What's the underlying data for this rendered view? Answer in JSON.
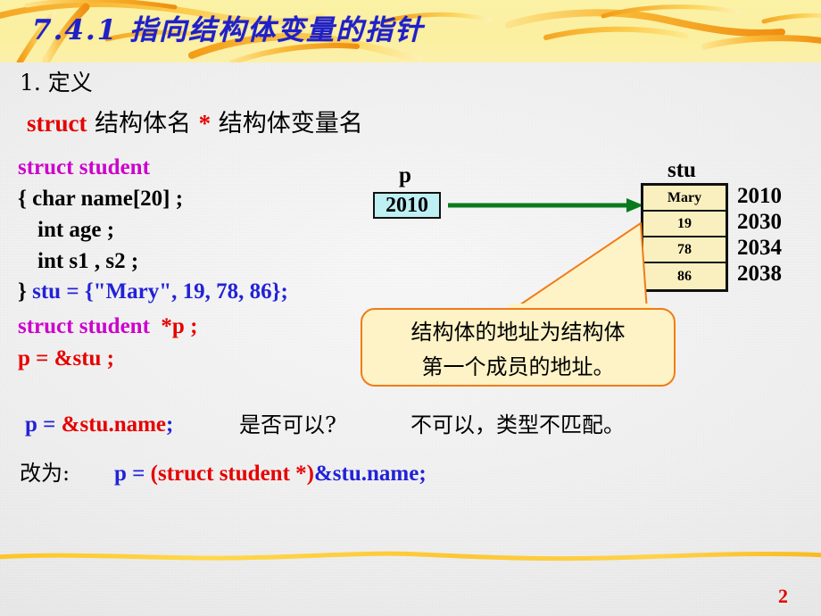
{
  "slide": {
    "title": "7.4.1 指向结构体变量的指针",
    "page_number": "2",
    "colors": {
      "banner_bg": "#fbefa0",
      "title_text": "#2020c8",
      "keyword_red": "#e60000",
      "code_blue": "#2222d8",
      "type_magenta": "#cc00cc",
      "pointer_box_fill": "#bdeff3",
      "struct_cell_fill": "#faf0bf",
      "callout_fill": "#fdf3c6",
      "callout_border": "#f07c18",
      "arrow_green": "#0a7a1e",
      "page_number_red": "#e00000"
    }
  },
  "body": {
    "section_label": "1. 定义",
    "syntax": {
      "keyword": "struct",
      "type_name": "结构体名",
      "star": "*",
      "var_name": "结构体变量名"
    },
    "code": {
      "struct_kw": "struct   student",
      "member_char": "{  char   name[20] ;",
      "member_age": "int   age ;",
      "member_s1s2": "int   s1 , s2 ;",
      "init_brace": "}",
      "init_rest": "stu = {\"Mary\", 19, 78, 86};",
      "decl_type": "struct  student",
      "decl_ptr": "*p ;",
      "assign": "p = &stu ;"
    },
    "question": {
      "code_blue_1": "p = ",
      "code_red": "&stu.name",
      "code_blue_2": ";",
      "cn_question": "是否可以?",
      "cn_answer": "不可以，类型不匹配。"
    },
    "fix": {
      "cn_label": "改为:",
      "code_blue_1": "p = ",
      "code_red": "(struct student *)",
      "code_blue_2": "&stu.name;"
    }
  },
  "diagram": {
    "pointer": {
      "label": "p",
      "value": "2010"
    },
    "struct_var": {
      "label": "stu",
      "members": [
        "Mary",
        "19",
        "78",
        "86"
      ],
      "addresses": [
        "2010",
        "2030",
        "2034",
        "2038"
      ]
    },
    "callout": {
      "line1": "结构体的地址为结构体",
      "line2": "第一个成员的地址。"
    }
  }
}
